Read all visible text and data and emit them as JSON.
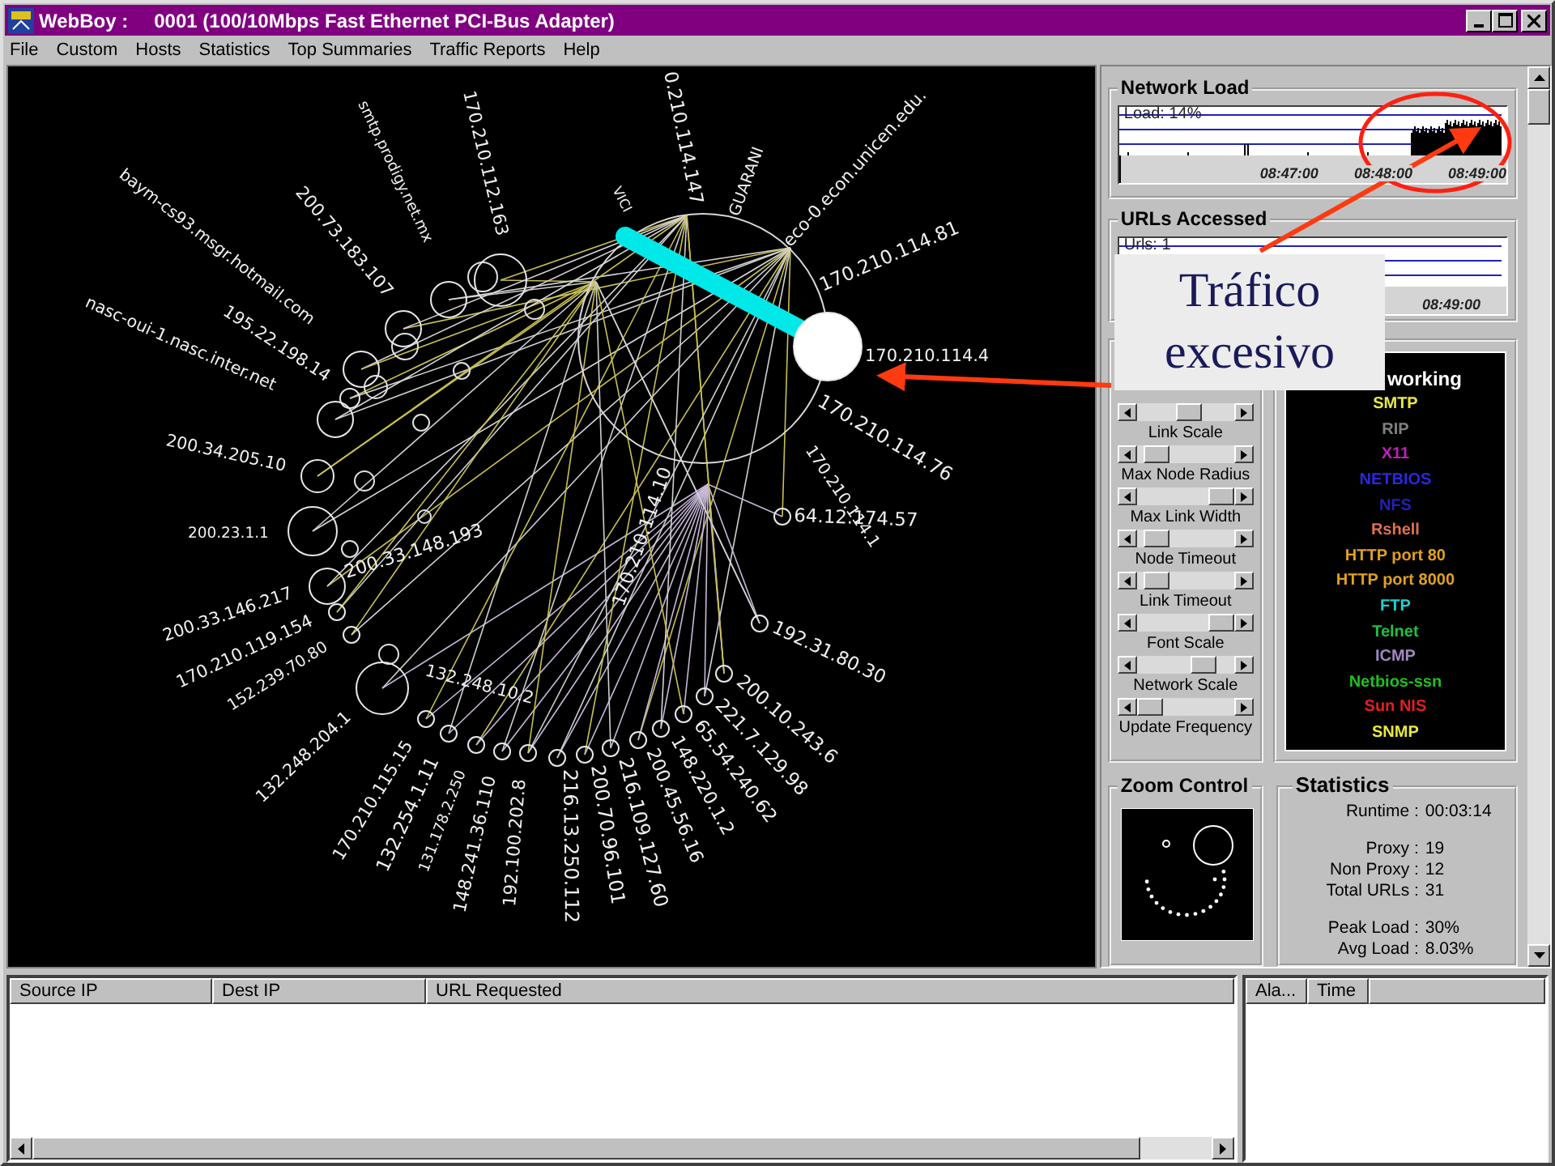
{
  "window": {
    "app_name": "WebBoy :",
    "title": "0001 (100/10Mbps Fast Ethernet PCI-Bus Adapter)"
  },
  "menu": [
    "File",
    "Custom",
    "Hosts",
    "Statistics",
    "Top Summaries",
    "Traffic Reports",
    "Help"
  ],
  "graph": {
    "nodes": [
      {
        "label": "170.210.112.163"
      },
      {
        "label": "smtp.prodigy.net.mx"
      },
      {
        "label": "200.73.183.107"
      },
      {
        "label": "baym-cs93.msgr.hotmail.com"
      },
      {
        "label": "195.22.198.14"
      },
      {
        "label": "nasc-oui-1.nasc.inter.net"
      },
      {
        "label": "200.34.205.10"
      },
      {
        "label": "200.23.1.1"
      },
      {
        "label": "200.33.146.217"
      },
      {
        "label": "170.210.119.154"
      },
      {
        "label": "152.239.70.80"
      },
      {
        "label": "132.248.204.1"
      },
      {
        "label": "170.210.115.15"
      },
      {
        "label": "132.254.1.11"
      },
      {
        "label": "131.178.2.250"
      },
      {
        "label": "148.241.36.110"
      },
      {
        "label": "192.100.202.8"
      },
      {
        "label": "216.13.250.112"
      },
      {
        "label": "200.70.96.101"
      },
      {
        "label": "216.109.127.60"
      },
      {
        "label": "200.45.56.16"
      },
      {
        "label": "148.220.1.2"
      },
      {
        "label": "65.54.240.62"
      },
      {
        "label": "221.7.129.98"
      },
      {
        "label": "200.10.243.6"
      },
      {
        "label": "192.31.80.30"
      },
      {
        "label": "64.12.174.57"
      },
      {
        "label": "170.210.114.1"
      },
      {
        "label": "170.210.114.76"
      },
      {
        "label": "170.210.114.4"
      },
      {
        "label": "170.210.114.81"
      },
      {
        "label": "eco-0.econ.unicen.edu."
      },
      {
        "label": "GUARANI"
      },
      {
        "label": "0.210.114.147"
      },
      {
        "label": "VICI"
      },
      {
        "label": "170.210.114.10"
      },
      {
        "label": "132.248.10.2"
      },
      {
        "label": "200.33.148.193"
      }
    ]
  },
  "network_load": {
    "title": "Network Load",
    "reading": "Load: 14%",
    "times": [
      "08:47:00",
      "08:48:00",
      "08:49:00"
    ]
  },
  "urls_accessed": {
    "title": "URLs Accessed",
    "reading": "Urls: 1",
    "times": [
      "08:49:00"
    ]
  },
  "sliders": [
    {
      "label": "Link Scale",
      "level": 0.55
    },
    {
      "label": "Max Node Radius",
      "level": 0.1
    },
    {
      "label": "Max Link Width",
      "level": 1
    },
    {
      "label": "Node Timeout",
      "level": 0.1
    },
    {
      "label": "Link Timeout",
      "level": 0.1
    },
    {
      "label": "Font Scale",
      "level": 1
    },
    {
      "label": "Network Scale",
      "level": 0.75
    },
    {
      "label": "Update Frequency",
      "level": 0
    }
  ],
  "legend": {
    "heading": "working",
    "items": [
      {
        "label": "SMTP",
        "color": "#e8e840"
      },
      {
        "label": "RIP",
        "color": "#808080"
      },
      {
        "label": "X11",
        "color": "#c020c0"
      },
      {
        "label": "NETBIOS",
        "color": "#2828e0"
      },
      {
        "label": "NFS",
        "color": "#2020b8"
      },
      {
        "label": "Rshell",
        "color": "#e07050"
      },
      {
        "label": "HTTP port 80",
        "color": "#e0a020"
      },
      {
        "label": "HTTP port 8000",
        "color": "#e0a020"
      },
      {
        "label": "FTP",
        "color": "#20d0d0"
      },
      {
        "label": "Telnet",
        "color": "#20c040"
      },
      {
        "label": "ICMP",
        "color": "#a088c0"
      },
      {
        "label": "Netbios-ssn",
        "color": "#20c020"
      },
      {
        "label": "Sun NIS",
        "color": "#e02020"
      },
      {
        "label": "SNMP",
        "color": "#e8e840"
      }
    ]
  },
  "zoom_control": {
    "title": "Zoom Control"
  },
  "statistics": {
    "title": "Statistics",
    "groups": [
      [
        {
          "label": "Runtime :",
          "value": "00:03:14"
        }
      ],
      [
        {
          "label": "Proxy :",
          "value": "19"
        },
        {
          "label": "Non Proxy :",
          "value": "12"
        },
        {
          "label": "Total URLs :",
          "value": "31"
        }
      ],
      [
        {
          "label": "Peak Load :",
          "value": "30%"
        },
        {
          "label": "Avg Load :",
          "value": "8.03%"
        }
      ]
    ]
  },
  "traffic_table": {
    "columns": [
      "Source IP",
      "Dest IP",
      "URL Requested"
    ]
  },
  "alarm_table": {
    "columns": [
      "Ala...",
      "Time"
    ]
  },
  "annotation": {
    "text": "Tráfico excesivo"
  }
}
